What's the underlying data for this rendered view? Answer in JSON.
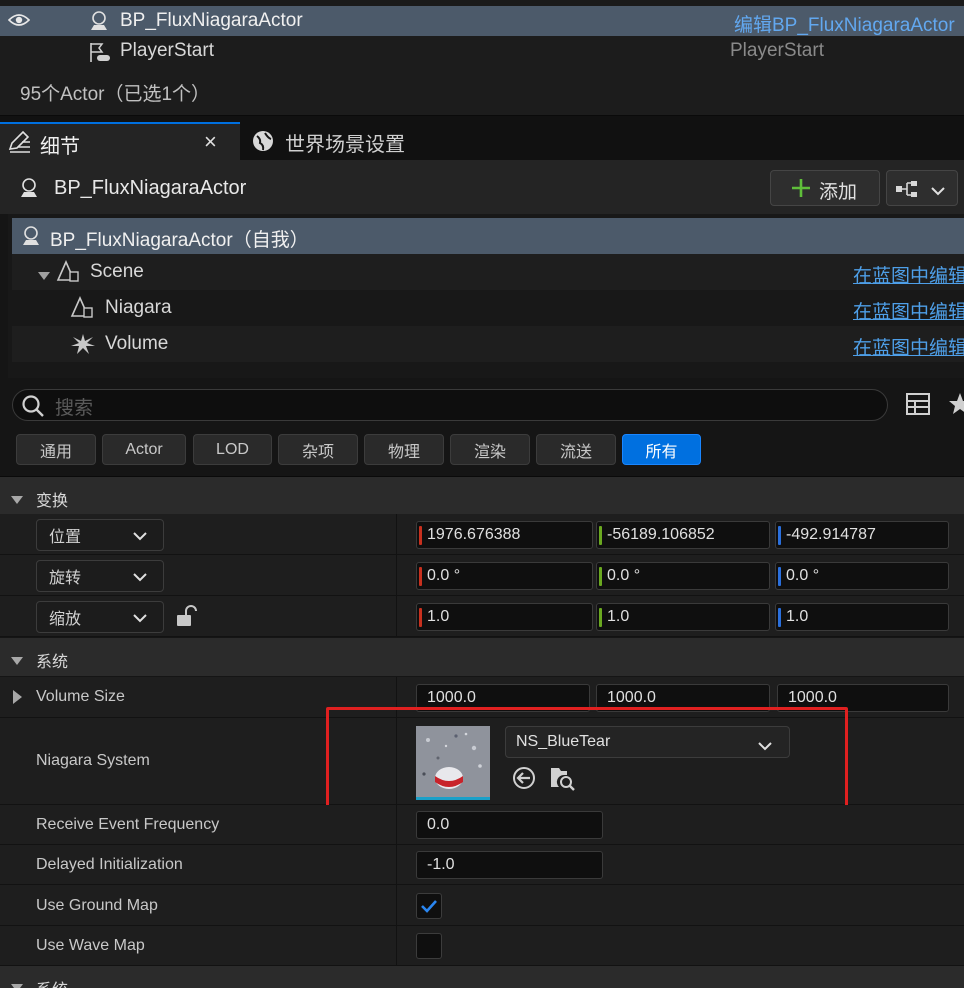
{
  "outliner": {
    "rows": [
      {
        "name": "BP_FluxNiagaraActor",
        "type": "编辑BP_FluxNiagaraActor"
      },
      {
        "name": "PlayerStart",
        "type": "PlayerStart"
      }
    ],
    "status": "95个Actor（已选1个）"
  },
  "tabs": [
    {
      "label": "细节",
      "close": "×"
    },
    {
      "label": "世界场景设置"
    }
  ],
  "header": {
    "title": "BP_FluxNiagaraActor",
    "add_label": "添加"
  },
  "components": [
    {
      "name": "BP_FluxNiagaraActor（自我）",
      "link": ""
    },
    {
      "name": "Scene",
      "link": "在蓝图中编辑"
    },
    {
      "name": "Niagara",
      "link": "在蓝图中编辑"
    },
    {
      "name": "Volume",
      "link": "在蓝图中编辑"
    }
  ],
  "search": {
    "placeholder": "搜索"
  },
  "filters": [
    "通用",
    "Actor",
    "LOD",
    "杂项",
    "物理",
    "渲染",
    "流送",
    "所有"
  ],
  "active_filter": "所有",
  "transform": {
    "section": "变换",
    "rows": [
      {
        "label": "位置",
        "x": "1976.676388",
        "y": "-56189.106852",
        "z": "-492.914787"
      },
      {
        "label": "旋转",
        "x": "0.0 °",
        "y": "0.0 °",
        "z": "0.0 °"
      },
      {
        "label": "缩放",
        "x": "1.0",
        "y": "1.0",
        "z": "1.0"
      }
    ]
  },
  "system": {
    "section": "系统",
    "volume_size": {
      "label": "Volume Size",
      "x": "1000.0",
      "y": "1000.0",
      "z": "1000.0"
    },
    "niagara_system": {
      "label": "Niagara System",
      "asset": "NS_BlueTear"
    },
    "receive_event": {
      "label": "Receive Event Frequency",
      "value": "0.0"
    },
    "delayed_init": {
      "label": "Delayed Initialization",
      "value": "-1.0"
    },
    "use_ground_map": {
      "label": "Use Ground Map",
      "checked": true
    },
    "use_wave_map": {
      "label": "Use Wave Map",
      "checked": false
    }
  },
  "next_section": "系统",
  "colors": {
    "x_axis": "#c8301e",
    "y_axis": "#6aa820",
    "z_axis": "#2a6fdc",
    "accent": "#0070e0",
    "link": "#4e9fe8",
    "highlight_box": "#e02020"
  }
}
